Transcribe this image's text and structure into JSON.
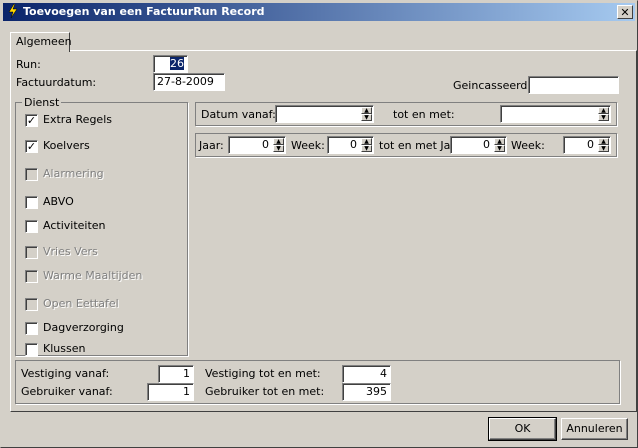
{
  "window": {
    "title": "Toevoegen van een FactuurRun Record"
  },
  "tabs": [
    {
      "label": "Algemeen"
    }
  ],
  "run": {
    "label": "Run:",
    "value": "26"
  },
  "factuurdatum": {
    "label": "Factuurdatum:",
    "value": "27-8-2009"
  },
  "geincasseerd": {
    "label": "Geincasseerd:",
    "value": ""
  },
  "dienst": {
    "legend": "Dienst",
    "items": [
      {
        "label": "Extra Regels",
        "checked": true,
        "enabled": true
      },
      {
        "label": "Koelvers",
        "checked": true,
        "enabled": true
      },
      {
        "label": "Alarmering",
        "checked": false,
        "enabled": false
      },
      {
        "label": "ABVO",
        "checked": false,
        "enabled": true
      },
      {
        "label": "Activiteiten",
        "checked": false,
        "enabled": true
      },
      {
        "label": "Vries Vers",
        "checked": false,
        "enabled": false
      },
      {
        "label": "Warme Maaltijden",
        "checked": false,
        "enabled": false
      },
      {
        "label": "Open Eettafel",
        "checked": false,
        "enabled": false
      },
      {
        "label": "Dagverzorging",
        "checked": false,
        "enabled": true
      },
      {
        "label": "Klussen",
        "checked": false,
        "enabled": true
      }
    ]
  },
  "datum": {
    "vanaf_label": "Datum vanaf:",
    "vanaf_value": "",
    "totmet_label": "tot en met:",
    "totmet_value": ""
  },
  "periode": {
    "jaar_label": "Jaar:",
    "jaar_value": "0",
    "week_label": "Week:",
    "week_value": "0",
    "totmet_jaar_label": "tot en met Jaar",
    "totmet_jaar_value": "0",
    "totmet_week_label": "Week:",
    "totmet_week_value": "0"
  },
  "vestiging": {
    "vanaf_label": "Vestiging vanaf:",
    "vanaf_value": "1",
    "totmet_label": "Vestiging tot en met:",
    "totmet_value": "4"
  },
  "gebruiker": {
    "vanaf_label": "Gebruiker vanaf:",
    "vanaf_value": "1",
    "totmet_label": "Gebruiker tot en met:",
    "totmet_value": "395"
  },
  "buttons": {
    "ok": "OK",
    "cancel": "Annuleren"
  },
  "icons": {
    "app": "lightning-icon",
    "close": "close-icon",
    "spin_up": "arrow-up-icon",
    "spin_down": "arrow-down-icon"
  }
}
